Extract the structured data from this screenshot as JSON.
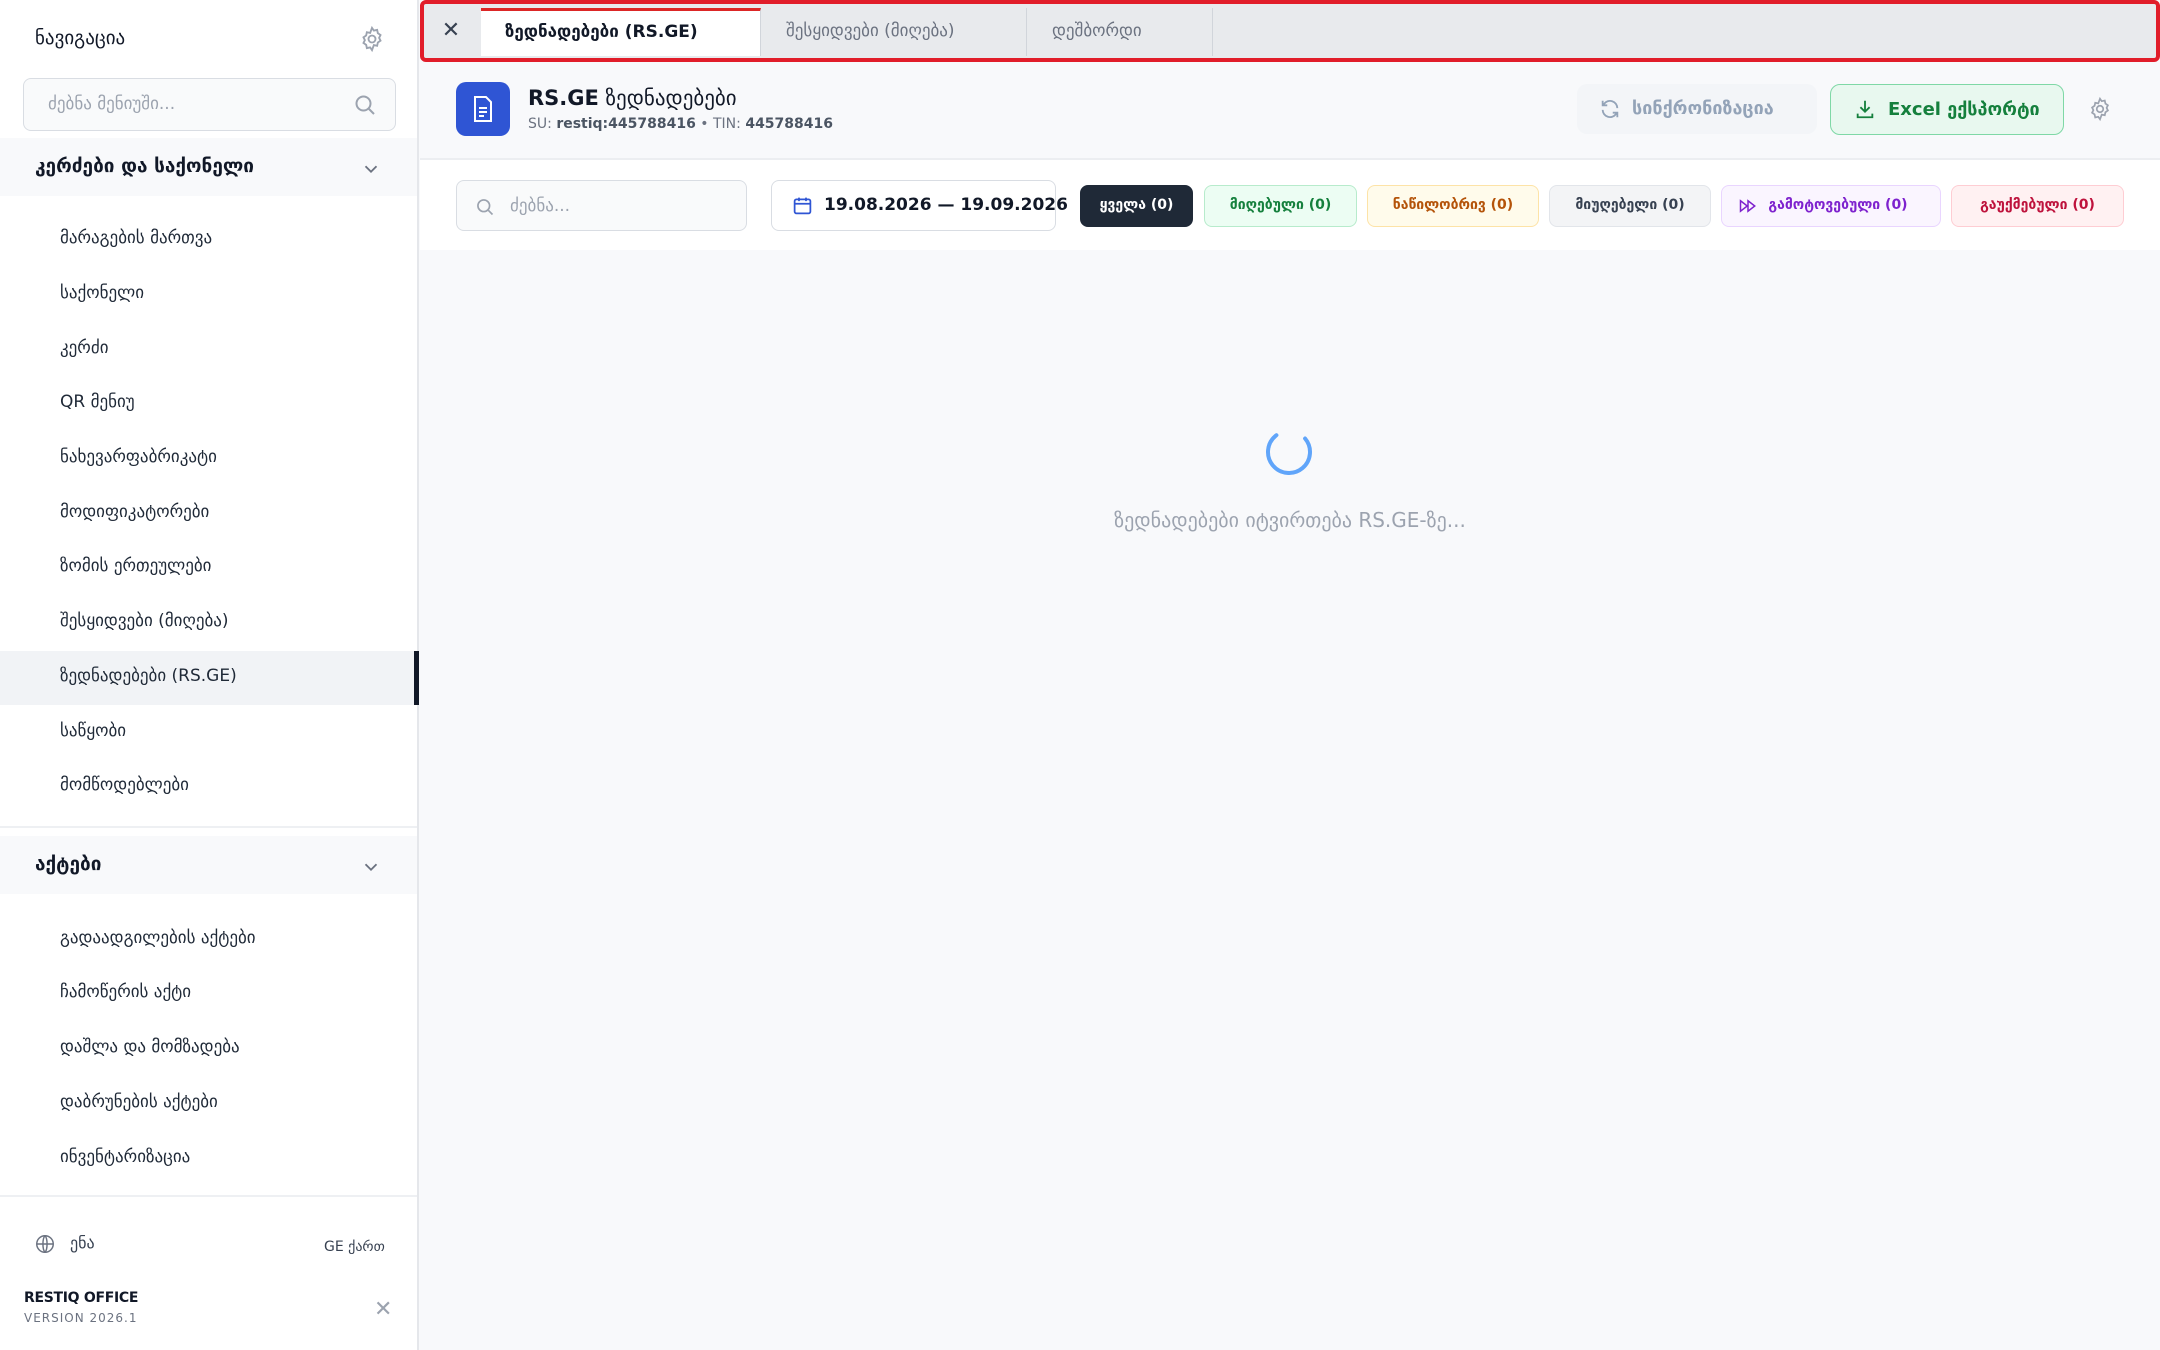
{
  "sidebar": {
    "title": "ნავიგაცია",
    "search_placeholder": "ძებნა მენიუში...",
    "groups": [
      {
        "label": "კერძები და საქონელი",
        "items": [
          {
            "label": "მარაგების მართვა"
          },
          {
            "label": "საქონელი"
          },
          {
            "label": "კერძი"
          },
          {
            "label": "QR მენიუ"
          },
          {
            "label": "ნახევარფაბრიკატი"
          },
          {
            "label": "მოდიფიკატორები"
          },
          {
            "label": "ზომის ერთეულები"
          },
          {
            "label": "შესყიდვები (მიღება)"
          },
          {
            "label": "ზედნადებები (RS.GE)",
            "active": true
          },
          {
            "label": "საწყობი"
          },
          {
            "label": "მომწოდებლები"
          }
        ]
      },
      {
        "label": "აქტები",
        "items": [
          {
            "label": "გადაადგილების აქტები"
          },
          {
            "label": "ჩამოწერის აქტი"
          },
          {
            "label": "დაშლა და მომზადება"
          },
          {
            "label": "დაბრუნების აქტები"
          },
          {
            "label": "ინვენტარიზაცია"
          }
        ]
      }
    ],
    "footer": {
      "language_label": "ენა",
      "language_value": "GE ქართ",
      "brand": "RESTIQ OFFICE",
      "version": "VERSION 2026.1"
    }
  },
  "tabs": [
    {
      "label": "ზედნადებები (RS.GE)",
      "active": true
    },
    {
      "label": "შესყიდვები (მიღება)"
    },
    {
      "label": "დეშბორდი"
    }
  ],
  "header": {
    "title_bold": "RS.GE",
    "title_rest": "ზედნადებები",
    "su_label": "SU:",
    "su_value": "restiq:445788416",
    "tin_label": "TIN:",
    "tin_value": "445788416",
    "sync_label": "სინქრონიზაცია",
    "export_label": "Excel ექსპორტი"
  },
  "filters": {
    "search_placeholder": "ძებნა...",
    "date_range": "19.08.2026 — 19.09.2026",
    "chips": [
      {
        "label": "ყველა (0)",
        "color": "#111827",
        "active": true
      },
      {
        "label": "მიღებული (0)",
        "color": "#15803d"
      },
      {
        "label": "ნაწილობრივ (0)",
        "color": "#b45309"
      },
      {
        "label": "მიუღებელი (0)",
        "color": "#374151"
      },
      {
        "label": "გამოტოვებული (0)",
        "color": "#7e22ce"
      },
      {
        "label": "გაუქმებული (0)",
        "color": "#be123c"
      }
    ]
  },
  "loading_text": "ზედნადებები იტვირთება RS.GE-ზე..."
}
